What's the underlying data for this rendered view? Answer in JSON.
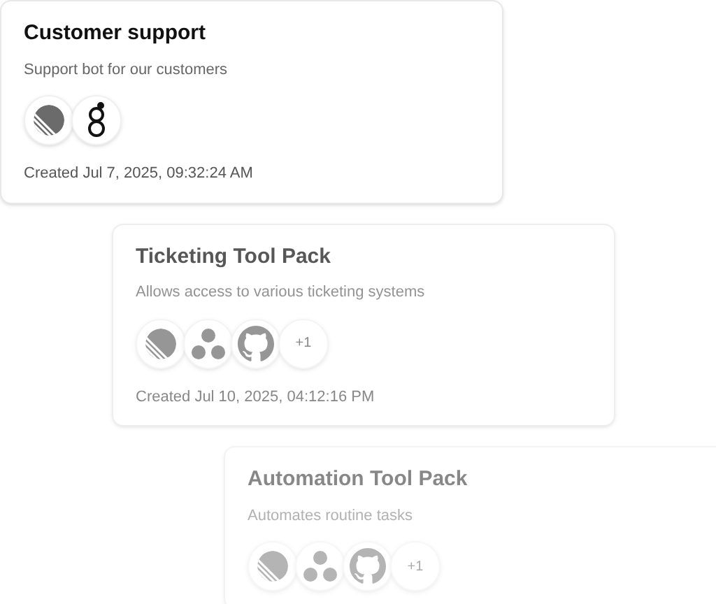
{
  "cards": [
    {
      "title": "Customer support",
      "description": "Support bot for our customers",
      "tools": [
        {
          "kind": "striped-circle"
        },
        {
          "kind": "ring-logo"
        }
      ],
      "created": "Created Jul 7, 2025, 09:32:24 AM"
    },
    {
      "title": "Ticketing Tool Pack",
      "description": "Allows access to various ticketing systems",
      "tools": [
        {
          "kind": "striped-circle"
        },
        {
          "kind": "three-dots"
        },
        {
          "kind": "octocat"
        }
      ],
      "more": "+1",
      "created": "Created Jul 10, 2025, 04:12:16 PM"
    },
    {
      "title": "Automation Tool Pack",
      "description": "Automates routine tasks",
      "tools": [
        {
          "kind": "striped-circle"
        },
        {
          "kind": "three-dots"
        },
        {
          "kind": "octocat"
        }
      ],
      "more": "+1"
    }
  ]
}
